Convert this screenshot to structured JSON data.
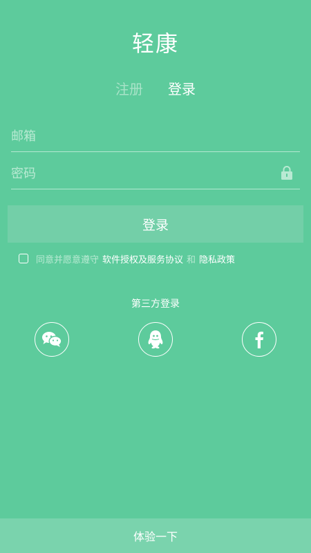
{
  "app": {
    "title": "轻康"
  },
  "tabs": [
    {
      "label": "注册",
      "active": false
    },
    {
      "label": "登录",
      "active": true
    }
  ],
  "form": {
    "email_placeholder": "邮箱",
    "password_placeholder": "密码",
    "lock_icon": "lock-icon",
    "submit_label": "登录"
  },
  "agreement": {
    "checked": false,
    "prefix": "同意并愿意遵守",
    "terms_link": "软件授权及服务协议",
    "and": "和",
    "privacy_link": "隐私政策"
  },
  "third_party": {
    "title": "第三方登录",
    "providers": [
      {
        "name": "wechat",
        "icon": "wechat-icon"
      },
      {
        "name": "qq",
        "icon": "qq-icon"
      },
      {
        "name": "facebook",
        "icon": "facebook-icon"
      }
    ]
  },
  "footer": {
    "trial_label": "体验一下"
  },
  "colors": {
    "background": "#5dcb9c",
    "button": "#73cfa8",
    "footer": "#7ad3ad",
    "inactive_text": "#a9e3c8"
  }
}
